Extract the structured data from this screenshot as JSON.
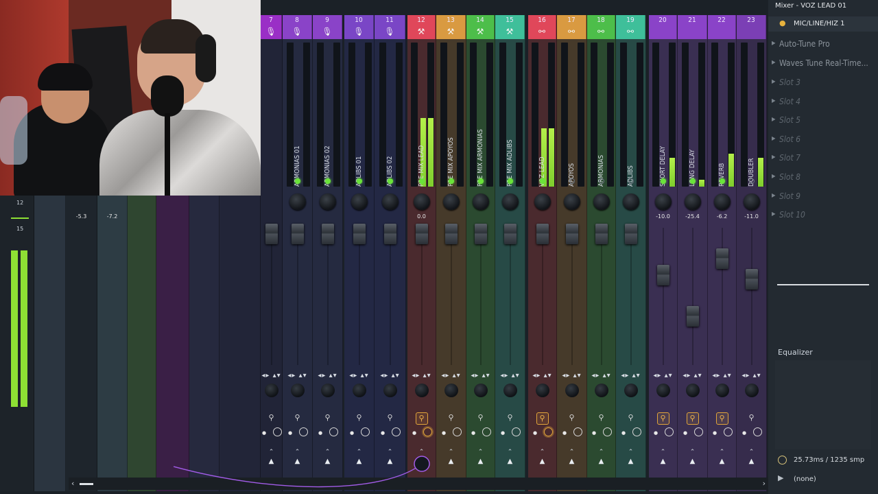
{
  "window": {
    "title": "Mixer - VOZ LEAD 01"
  },
  "insert": {
    "input_label": "MIC/LINE/HIZ 1"
  },
  "slots": [
    {
      "label": "Auto-Tune Pro"
    },
    {
      "label": "Waves Tune Real-Time..."
    },
    {
      "label": "Slot 3"
    },
    {
      "label": "Slot 4"
    },
    {
      "label": "Slot 5"
    },
    {
      "label": "Slot 6"
    },
    {
      "label": "Slot 7"
    },
    {
      "label": "Slot 8"
    },
    {
      "label": "Slot 9"
    },
    {
      "label": "Slot 10"
    }
  ],
  "equalizer_label": "Equalizer",
  "latency": "25.73ms / 1235 smp",
  "output": "(none)",
  "master": {
    "scale_top": "12",
    "scale_mid": "15"
  },
  "left_gains": [
    "-5.3",
    "-7.2"
  ],
  "tracks": [
    {
      "num": "7",
      "name": "",
      "color": "#9a2fc6",
      "icon": "mic-icon",
      "gain": ""
    },
    {
      "num": "8",
      "name": "ARMONIAS 01",
      "color": "#8a43c8",
      "icon": "mic-icon",
      "gain": ""
    },
    {
      "num": "9",
      "name": "ARMONIAS 02",
      "color": "#8a43c8",
      "icon": "mic-icon",
      "gain": ""
    },
    {
      "num": "10",
      "name": "ADLIBS 01",
      "color": "#7a46c6",
      "icon": "mic-icon",
      "gain": ""
    },
    {
      "num": "11",
      "name": "ADLIBS 02",
      "color": "#7a46c6",
      "icon": "mic-icon",
      "gain": ""
    },
    {
      "num": "12",
      "name": "PRE MIX LEAD",
      "color": "#e0475a",
      "icon": "wrench-icon",
      "gain": "0.0"
    },
    {
      "num": "13",
      "name": "PRE MIX APOYOS",
      "color": "#d99a41",
      "icon": "wrench-icon",
      "gain": ""
    },
    {
      "num": "14",
      "name": "PRE MIX ARMONIAS",
      "color": "#4dbe4a",
      "icon": "wrench-icon",
      "gain": ""
    },
    {
      "num": "15",
      "name": "PRE MIX ADLIBS",
      "color": "#3fbf9a",
      "icon": "wrench-icon",
      "gain": ""
    },
    {
      "num": "16",
      "name": "VOZ LEAD",
      "color": "#e0475a",
      "icon": "link-icon",
      "gain": ""
    },
    {
      "num": "17",
      "name": "APOYOS",
      "color": "#d99a41",
      "icon": "link-icon",
      "gain": ""
    },
    {
      "num": "18",
      "name": "ARMONIAS",
      "color": "#4dbe4a",
      "icon": "link-icon",
      "gain": ""
    },
    {
      "num": "19",
      "name": "ADLIBS",
      "color": "#3fbf9a",
      "icon": "link-icon",
      "gain": ""
    },
    {
      "num": "20",
      "name": "SHORT DELAY",
      "color": "#8a43c8",
      "icon": "",
      "gain": "-10.0"
    },
    {
      "num": "21",
      "name": "LONG DELAY",
      "color": "#8a43c8",
      "icon": "",
      "gain": "-25.4"
    },
    {
      "num": "22",
      "name": "REVERB",
      "color": "#8a43c8",
      "icon": "",
      "gain": "-6.2"
    },
    {
      "num": "23",
      "name": "DOUBLER",
      "color": "#7b3fb5",
      "icon": "",
      "gain": "-11.0"
    }
  ]
}
